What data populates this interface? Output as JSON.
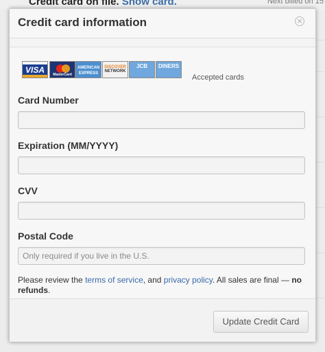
{
  "background": {
    "left_text": "Credit card on file.",
    "left_link": "Show card.",
    "right_text": "Next billed on 15"
  },
  "modal": {
    "title": "Credit card information",
    "close_icon": "×"
  },
  "cards": {
    "visa": "VISA",
    "mastercard": "MasterCard",
    "amex": "AMERICAN EXPRESS",
    "discover_top": "DISCOVER",
    "discover_bottom": "NETWORK",
    "jcb": "JCB",
    "diners": "DINERS",
    "accepted_label": "Accepted cards"
  },
  "form": {
    "card_number_label": "Card Number",
    "card_number_value": "",
    "expiration_label": "Expiration (MM/YYYY)",
    "expiration_value": "",
    "cvv_label": "CVV",
    "cvv_value": "",
    "postal_label": "Postal Code",
    "postal_placeholder": "Only required if you live in the U.S.",
    "postal_value": ""
  },
  "legal": {
    "prefix": "Please review the ",
    "tos_link": "terms of service",
    "middle": ", and ",
    "privacy_link": "privacy policy",
    "suffix": ". All sales are final — ",
    "bold": "no refunds",
    "end": "."
  },
  "footer": {
    "update_label": "Update Credit Card"
  }
}
